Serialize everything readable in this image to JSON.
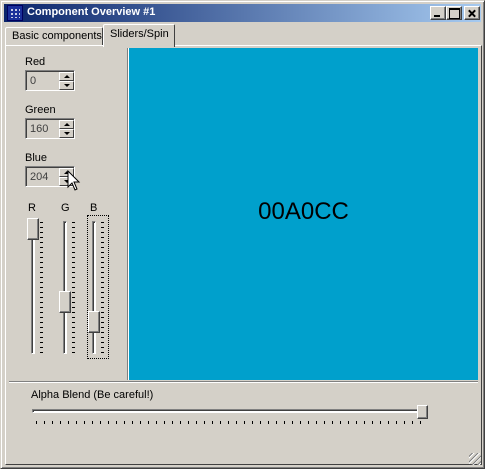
{
  "window": {
    "title": "Component Overview #1",
    "icon": "app-icon"
  },
  "tabs": [
    {
      "label": "Basic components",
      "selected": false
    },
    {
      "label": "Sliders/Spin",
      "selected": true
    }
  ],
  "spins": {
    "red": {
      "label": "Red",
      "value": "0"
    },
    "green": {
      "label": "Green",
      "value": "160"
    },
    "blue": {
      "label": "Blue",
      "value": "204"
    }
  },
  "sliders": {
    "r": {
      "label": "R",
      "value": 0,
      "max": 255
    },
    "g": {
      "label": "G",
      "value": 160,
      "max": 255
    },
    "b": {
      "label": "B",
      "value": 204,
      "max": 255,
      "focused": true
    }
  },
  "preview": {
    "hex": "00A0CC",
    "color": "#00A0CC"
  },
  "alpha": {
    "label": "Alpha Blend (Be careful!)",
    "value": 1.0
  }
}
